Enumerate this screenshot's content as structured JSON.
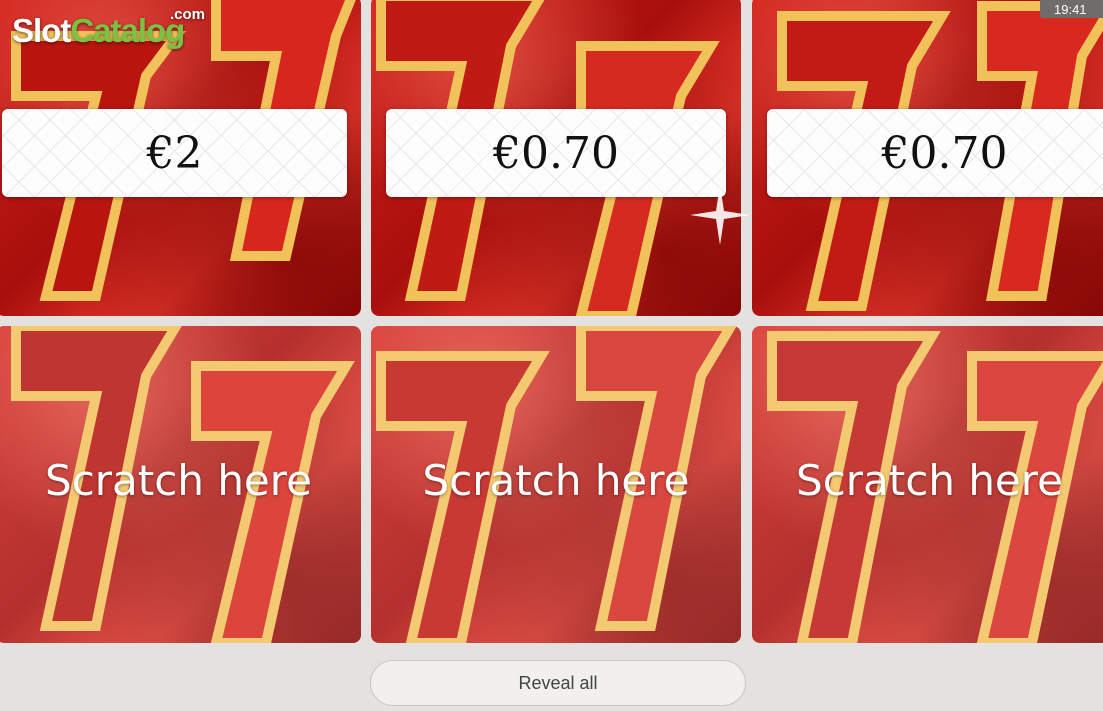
{
  "logo": {
    "slot": "Slot",
    "catalog": "Catalog",
    "tld": ".com"
  },
  "status_bar": {
    "time": "19:41"
  },
  "tiles": [
    {
      "state": "revealed",
      "prize": "€2"
    },
    {
      "state": "revealed",
      "prize": "€0.70"
    },
    {
      "state": "revealed",
      "prize": "€0.70"
    },
    {
      "state": "covered",
      "label": "Scratch here"
    },
    {
      "state": "covered",
      "label": "Scratch here"
    },
    {
      "state": "covered",
      "label": "Scratch here"
    }
  ],
  "reveal_button": {
    "label": "Reveal all"
  },
  "colors": {
    "tile_red": "#c81d17",
    "gold_outline": "#f2c25a",
    "background": "#e4e2e0"
  }
}
